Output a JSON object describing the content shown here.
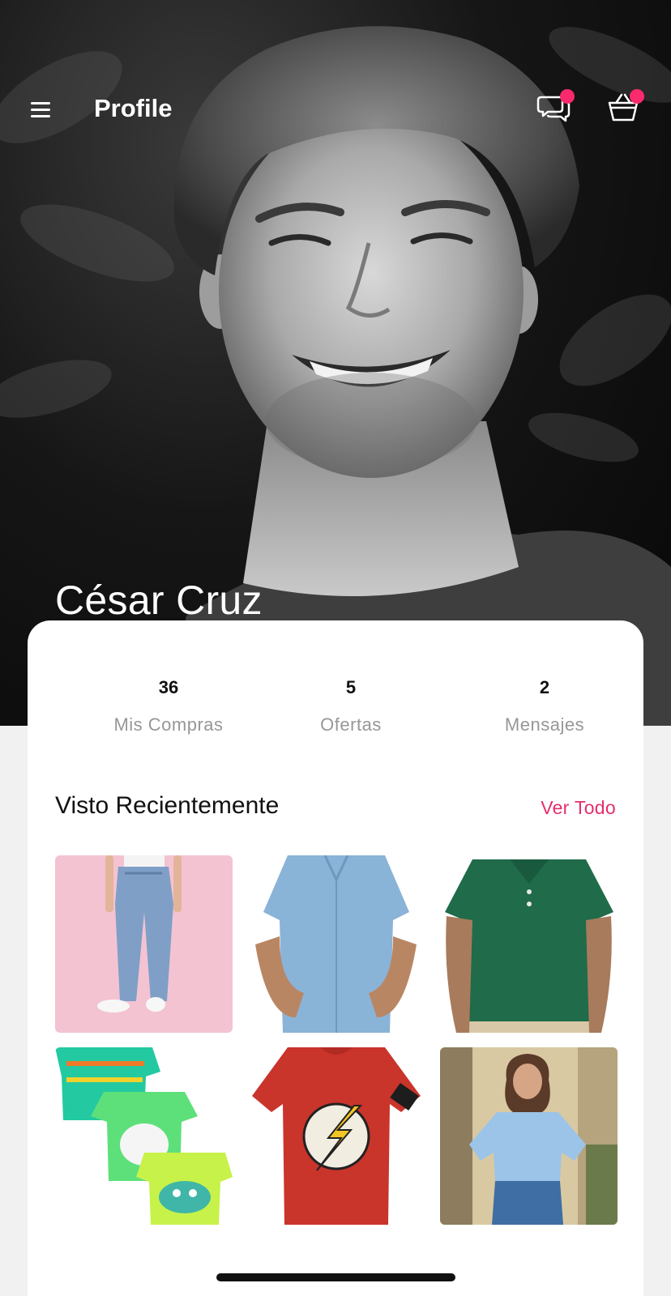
{
  "header": {
    "title": "Profile",
    "icons": [
      "menu-icon",
      "chat-icon",
      "cart-icon"
    ],
    "badge_color": "#fa2a6d"
  },
  "profile": {
    "name": "César Cruz"
  },
  "stats": [
    {
      "value": "36",
      "label": "Mis Compras"
    },
    {
      "value": "5",
      "label": "Ofertas"
    },
    {
      "value": "2",
      "label": "Mensajes"
    }
  ],
  "recent": {
    "title": "Visto Recientemente",
    "see_all_label": "Ver Todo",
    "accent": "#e62e6e"
  }
}
